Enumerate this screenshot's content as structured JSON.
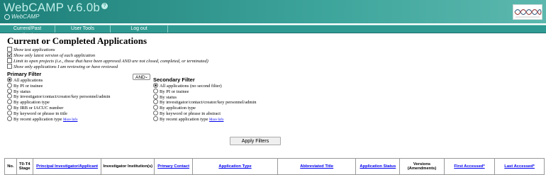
{
  "app": {
    "title": "WebCAMP v.6.0b",
    "subtitle": "WebCAMP"
  },
  "nav": {
    "items": [
      {
        "label": "Current/Past Applications"
      },
      {
        "label": "User Tools"
      },
      {
        "label": "Log out"
      }
    ]
  },
  "page": {
    "heading": "Current or Completed Applications",
    "options": [
      {
        "label": "Show test applications",
        "checked": false
      },
      {
        "label": "Show only latest version of each application",
        "checked": true
      },
      {
        "label": "Limit to open projects (i.e., those that have been approved AND are not closed, completed, or terminated)",
        "checked": false
      },
      {
        "label": "Show only applications I am reviewing or have reviewed",
        "checked": false
      }
    ]
  },
  "primary_filter": {
    "title": "Primary Filter",
    "options": [
      {
        "label": "All applications",
        "selected": true
      },
      {
        "label": "By PI or trainee",
        "selected": false
      },
      {
        "label": "By status",
        "selected": false
      },
      {
        "label": "By investigator/contact/creator/key personnel/admin",
        "selected": false
      },
      {
        "label": "By application type",
        "selected": false
      },
      {
        "label": "By IRB or IACUC number",
        "selected": false
      },
      {
        "label": "By keyword or phrase in title",
        "selected": false
      },
      {
        "label": "By recent application type",
        "selected": false,
        "more": "More Info"
      }
    ]
  },
  "operator": {
    "value": "AND"
  },
  "secondary_filter": {
    "title": "Secondary Filter",
    "options": [
      {
        "label": "All applications (no second filter)",
        "selected": true
      },
      {
        "label": "By PI or trainee",
        "selected": false
      },
      {
        "label": "By status",
        "selected": false
      },
      {
        "label": "By investigator/contact/creator/key personnel/admin",
        "selected": false
      },
      {
        "label": "By application type",
        "selected": false
      },
      {
        "label": "By keyword or phrase in abstract",
        "selected": false
      },
      {
        "label": "By recent application type",
        "selected": false,
        "more": "More Info"
      }
    ]
  },
  "apply_label": "Apply Filters",
  "table": {
    "columns": [
      {
        "label": "No.",
        "link": false
      },
      {
        "label": "T0-T4 Stage",
        "link": false
      },
      {
        "label": "Principal Investigator/Applicant",
        "link": true
      },
      {
        "label": "Investigator Institution(s)",
        "link": false
      },
      {
        "label": "Primary Contact",
        "link": true
      },
      {
        "label": "Application Type",
        "link": true
      },
      {
        "label": "Abbreviated Title",
        "link": true
      },
      {
        "label": "Application Status",
        "link": true
      },
      {
        "label": "Versions (Amendments)",
        "link": false
      },
      {
        "label": "First Accessed*",
        "link": true
      },
      {
        "label": "Last Accessed*",
        "link": true
      }
    ]
  },
  "icons": {
    "help": "help-icon",
    "search": "search-icon",
    "logo": "institution-logo"
  }
}
